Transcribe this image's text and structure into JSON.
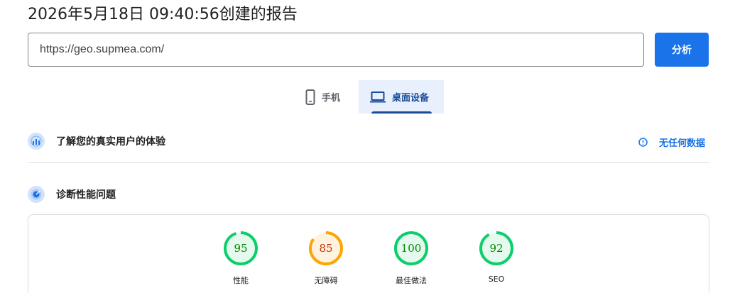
{
  "header": {
    "report_title": "2026年5月18日 09:40:56创建的报告"
  },
  "search": {
    "url_value": "https://geo.supmea.com/",
    "analyze_label": "分析"
  },
  "device_tabs": [
    {
      "label": "手机",
      "icon": "phone-icon",
      "selected": false
    },
    {
      "label": "桌面设备",
      "icon": "laptop-icon",
      "selected": true
    }
  ],
  "crux": {
    "title": "了解您的真实用户的体验",
    "status_label": "无任何数据",
    "icon": "crux-icon"
  },
  "diagnostics": {
    "title": "诊断性能问题",
    "icon": "lighthouse-icon"
  },
  "scores": [
    {
      "label": "性能",
      "value": "95",
      "score": 95,
      "status": "pass"
    },
    {
      "label": "无障碍",
      "value": "85",
      "score": 85,
      "status": "average"
    },
    {
      "label": "最佳做法",
      "value": "100",
      "score": 100,
      "status": "pass"
    },
    {
      "label": "SEO",
      "value": "92",
      "score": 92,
      "status": "pass"
    }
  ],
  "colors": {
    "accent": "#1a73e8",
    "tab_selected_bg": "#e8f0fe",
    "pass_stroke": "#0cce6b",
    "pass_fill": "#e6f9ee",
    "pass_text": "#008800",
    "average_stroke": "#ffa400",
    "average_fill": "#fff3e0",
    "average_text": "#c33300"
  }
}
